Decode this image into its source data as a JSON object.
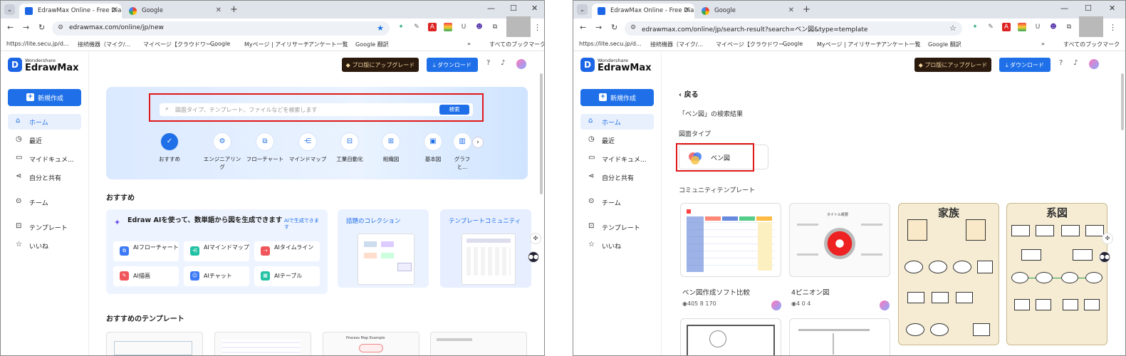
{
  "left": {
    "tabs": [
      {
        "title": "EdrawMax Online - Free Diagra"
      },
      {
        "title": "Google"
      }
    ],
    "url": "edrawmax.com/online/jp/new",
    "bookmarks": [
      "https://lite.secu.jp/d...",
      "接続機器（マイク/...",
      "マイページ【クラウドワー...",
      "Google",
      "Myページ | アイリサーチ",
      "アンケート一覧",
      "Google 翻訳",
      "すべてのブックマーク"
    ],
    "brand": {
      "small": "Wondershare",
      "big": "EdrawMax"
    },
    "new_button": "新規作成",
    "nav": [
      "ホーム",
      "最近",
      "マイドキュメ...",
      "自分と共有",
      "チーム",
      "テンプレート",
      "いいね"
    ],
    "upgrade_label": "プロ版にアップグレード",
    "download_label": "ダウンロード",
    "search": {
      "placeholder": "図面タイプ、テンプレート、ファイルなどを検索します",
      "button": "検索"
    },
    "categories": [
      "おすすめ",
      "エンジニアリング",
      "フローチャート",
      "マインドマップ",
      "工業自動化",
      "組織図",
      "基本図",
      "グラフと..."
    ],
    "section_recommend": "おすすめ",
    "ai": {
      "title": "Edraw AIを使って、数単語から図を生成できます",
      "sub": "AIで生成できます",
      "buttons": [
        "AIフローチャート",
        "AIマインドマップ",
        "AIタイムライン",
        "AI描画",
        "AIチャット",
        "AIテーブル"
      ]
    },
    "promos": [
      "話題のコレクション",
      "テンプレートコミュニティ"
    ],
    "section_templates": "おすすめのテンプレート",
    "template_caption": "Process Map Example"
  },
  "right": {
    "tabs": [
      {
        "title": "EdrawMax Online - Free Diagra"
      },
      {
        "title": "Google"
      }
    ],
    "url": "edrawmax.com/online/jp/search-result?search=ベン図&type=template",
    "bookmarks": [
      "https://lite.secu.jp/d...",
      "接続機器（マイク/...",
      "マイページ【クラウドワー...",
      "Google",
      "Myページ | アイリサーチ",
      "アンケート一覧",
      "Google 翻訳",
      "すべてのブックマーク"
    ],
    "brand": {
      "small": "Wondershare",
      "big": "EdrawMax"
    },
    "new_button": "新規作成",
    "nav": [
      "ホーム",
      "最近",
      "マイドキュメ...",
      "自分と共有",
      "チーム",
      "テンプレート",
      "いいね"
    ],
    "upgrade_label": "プロ版にアップグレード",
    "download_label": "ダウンロード",
    "back_label": "戻る",
    "result_heading": "「ベン図」の検索結果",
    "diagram_type_heading": "図面タイプ",
    "diagram_type": "ベン図",
    "community_heading": "コミュニティテンプレート",
    "templates": [
      {
        "title": "ベン図作成ソフト比較",
        "meta": "405 8 170"
      },
      {
        "title": "4ピニオン図",
        "meta": "4 0 4"
      },
      {
        "title": "家族",
        "meta": ""
      },
      {
        "title": "系図",
        "meta": ""
      }
    ],
    "card2_caption": "タイトル概要"
  }
}
